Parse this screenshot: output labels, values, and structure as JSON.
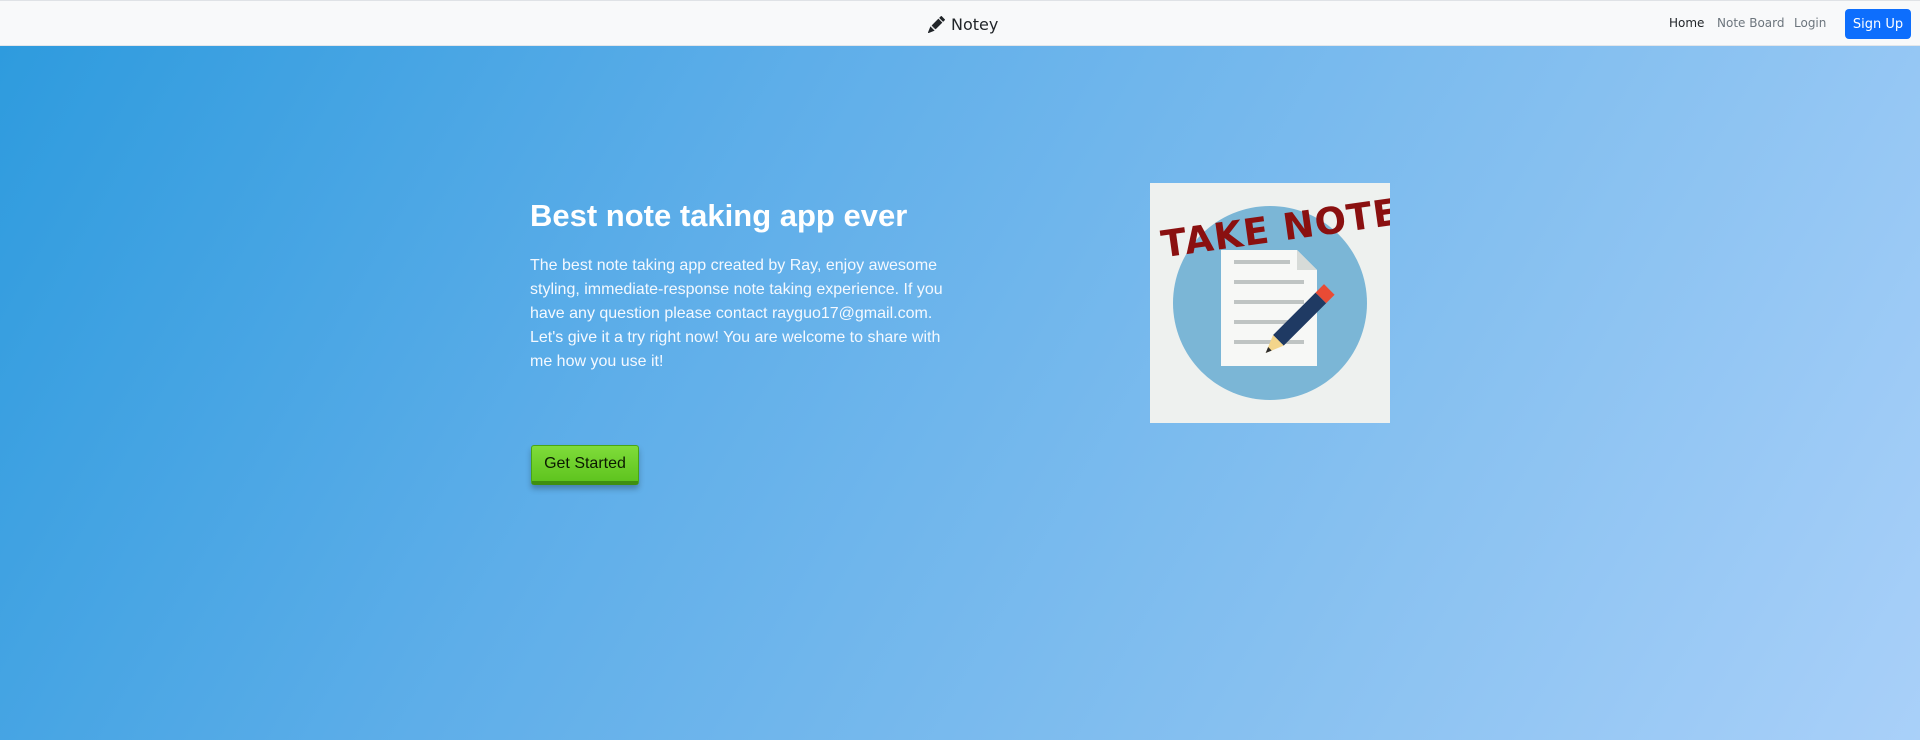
{
  "navbar": {
    "brand": {
      "label": "Notey",
      "icon": "pencil-icon"
    },
    "links": [
      {
        "label": "Home",
        "active": true
      },
      {
        "label": "Note Board",
        "active": false
      },
      {
        "label": "Login",
        "active": false
      }
    ],
    "signup_label": "Sign Up"
  },
  "hero": {
    "title": "Best note taking app ever",
    "description": "The best note taking app created by Ray, enjoy awesome styling, immediate-response note taking experience. If you have any question please contact rayguo17@gmail.com. Let's give it a try right now! You are welcome to share with me how you use it!",
    "cta_label": "Get Started",
    "logo": {
      "icon": "take-note-logo",
      "text": "TAKE NOTE"
    }
  },
  "colors": {
    "accent": "#0d6efd",
    "cta": "#6ccf2a",
    "hero_gradient_start": "#2e9bde",
    "hero_gradient_end": "#a9d0f9",
    "logo_text": "#8a1010"
  }
}
